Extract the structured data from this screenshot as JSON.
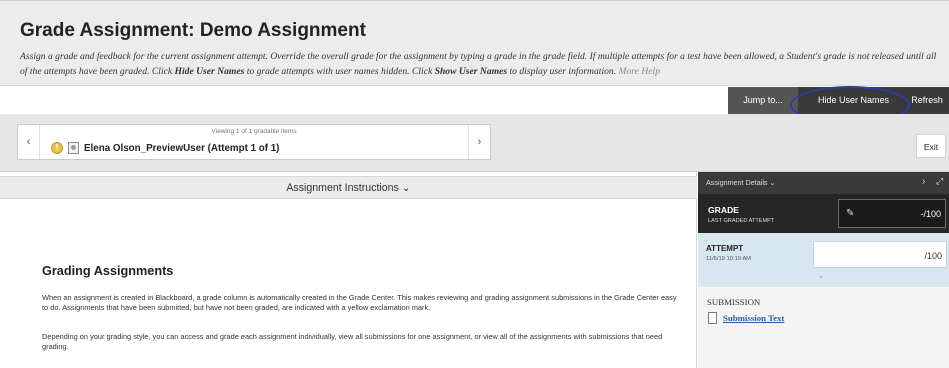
{
  "header": {
    "title": "Grade Assignment: Demo Assignment",
    "instructions": {
      "part1": "Assign a grade and feedback for the current assignment attempt. Override the overall grade for the assignment by typing a grade in the grade field. If multiple attempts for a test have been allowed, a Student's grade is not released until all of the attempts have been graded. Click ",
      "bold1": "Hide User Names",
      "part2": " to grade attempts with user names hidden. Click ",
      "bold2": "Show User Names",
      "part3": " to display user information. ",
      "more_help": "More Help"
    }
  },
  "toolbar": {
    "jump_to": "Jump to...",
    "hide_user_names": "Hide User Names",
    "refresh": "Refresh"
  },
  "navigator": {
    "viewing": "Viewing 1 of 1 gradable items",
    "prev_icon": "chevron-left-icon",
    "next_icon": "chevron-right-icon",
    "user": "Elena Olson_PreviewUser (Attempt 1 of 1)",
    "exit": "Exit"
  },
  "content": {
    "instructions_bar": "Assignment Instructions ⌄",
    "heading": "Grading Assignments",
    "para1": "When an assignment is created in Blackboard, a grade column is automatically created in the Grade Center. This makes reviewing and grading assignment submissions in the Grade Center easy to do. Assignments that have been submitted, but have not been graded, are indicated with a yellow exclamation mark.",
    "para2": "Depending on your grading style, you can access and grade each assignment individually, view all submissions for one assignment, or view all of the assignments with submissions that need grading."
  },
  "details": {
    "title": "Assignment Details ⌄",
    "grade_title": "GRADE",
    "grade_sub": "LAST GRADED ATTEMPT",
    "grade_value": "-/100",
    "attempt_title": "ATTEMPT",
    "attempt_date": "11/6/19 10:19 AM",
    "attempt_value": "/100",
    "submission_label": "SUBMISSION",
    "submission_link": "Submission Text"
  },
  "colors": {
    "dark_bar": "#3a3a3a",
    "grade_block": "#262626",
    "attempt_block": "#d6e7ef",
    "highlight_ring": "#2f3ca8",
    "link": "#2a5aa0"
  }
}
